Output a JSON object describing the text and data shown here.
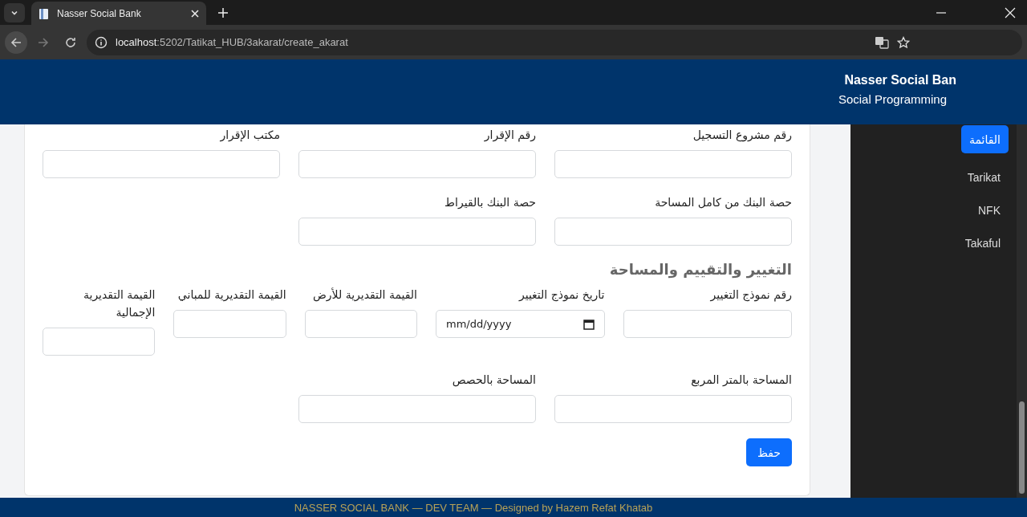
{
  "browser": {
    "tab_title": "Nasser Social Bank",
    "url_host": "localhost",
    "url_path": ":5202/Tatikat_HUB/3akarat/create_akarat",
    "forward_disabled": true
  },
  "header": {
    "title": "Nasser Social Ban",
    "subtitle": "Social Programming"
  },
  "sidebar": {
    "items": [
      {
        "label": "القائمة",
        "selected": true
      },
      {
        "label": "Tarikat",
        "selected": false
      },
      {
        "label": "NFK",
        "selected": false
      },
      {
        "label": "Takaful",
        "selected": false
      }
    ]
  },
  "form": {
    "sections": [
      {
        "rows": [
          [
            {
              "label": "رقم مشروع التسجيل",
              "kind": "text"
            },
            {
              "label": "رقم الإقرار",
              "kind": "text"
            },
            {
              "label": "مكتب الإقرار",
              "kind": "text"
            }
          ],
          [
            {
              "label": "حصة البنك من كامل المساحة",
              "kind": "text"
            },
            {
              "label": "حصة البنك بالقيراط",
              "kind": "text"
            }
          ]
        ]
      },
      {
        "heading": "التغيير والتقييم والمساحة",
        "rows": [
          [
            {
              "label": "رقم نموذج التغيير",
              "kind": "text"
            },
            {
              "label": "تاريخ نموذج التغيير",
              "kind": "date",
              "placeholder": "mm/dd/yyyy"
            },
            {
              "label": "القيمة التقديرية للأرض",
              "kind": "text"
            },
            {
              "label": "القيمة التقديرية للمباني",
              "kind": "text"
            },
            {
              "label": "القيمة التقديرية الإجمالية",
              "kind": "text"
            }
          ],
          [
            {
              "label": "المساحة بالمتر المربع",
              "kind": "text"
            },
            {
              "label": "المساحة بالحصص",
              "kind": "text"
            }
          ]
        ]
      }
    ],
    "submit": "حفظ"
  },
  "footer": "NASSER SOCIAL BANK — DEV TEAM — Designed by Hazem Refat Khatab"
}
